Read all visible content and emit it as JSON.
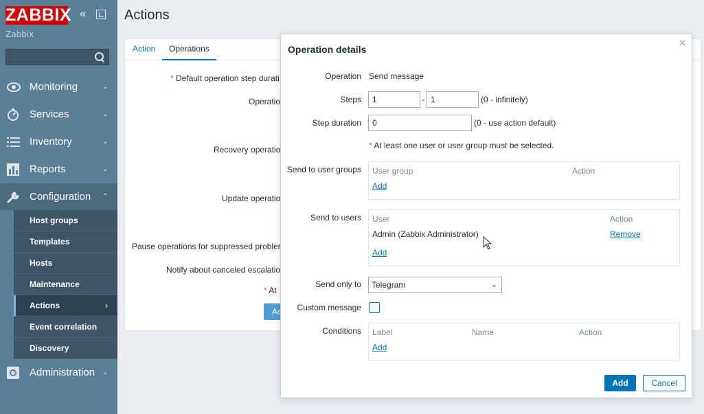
{
  "sidebar": {
    "logo": "ZABBIX",
    "server_name": "Zabbix",
    "search_placeholder": "",
    "menu": [
      {
        "label": "Monitoring",
        "icon": "eye-icon"
      },
      {
        "label": "Services",
        "icon": "stopwatch-icon"
      },
      {
        "label": "Inventory",
        "icon": "list-icon"
      },
      {
        "label": "Reports",
        "icon": "bar-chart-icon"
      },
      {
        "label": "Configuration",
        "icon": "wrench-icon"
      },
      {
        "label": "Administration",
        "icon": "gear-icon"
      }
    ],
    "submenu": [
      {
        "label": "Host groups"
      },
      {
        "label": "Templates"
      },
      {
        "label": "Hosts"
      },
      {
        "label": "Maintenance"
      },
      {
        "label": "Actions",
        "active": true
      },
      {
        "label": "Event correlation"
      },
      {
        "label": "Discovery"
      }
    ]
  },
  "main": {
    "title": "Actions",
    "tabs": [
      {
        "label": "Action"
      },
      {
        "label": "Operations"
      }
    ],
    "form": {
      "default_step_duration": "Default operation step durati",
      "operations": "Operatio",
      "recovery_operations": "Recovery operatio",
      "update_operations": "Update operatio",
      "pause_suppressed": "Pause operations for suppressed probler",
      "notify_canceled": "Notify about canceled escalatio",
      "at_least": "At",
      "button": "Ac"
    }
  },
  "modal": {
    "title": "Operation details",
    "close": "×",
    "operation_label": "Operation",
    "operation_value": "Send message",
    "steps_label": "Steps",
    "steps_from": "1",
    "steps_sep": "-",
    "steps_to": "1",
    "steps_hint": "(0 - infinitely)",
    "step_duration_label": "Step duration",
    "step_duration_value": "0",
    "step_duration_hint": "(0 - use action default)",
    "requirement_note": "At least one user or user group must be selected.",
    "user_groups_label": "Send to user groups",
    "user_groups_headers": {
      "col1": "User group",
      "col2": "Action"
    },
    "add_link": "Add",
    "users_label": "Send to users",
    "users_headers": {
      "col1": "User",
      "col2": "Action"
    },
    "users_rows": [
      {
        "user": "Admin (Zabbix Administrator)",
        "action": "Remove"
      }
    ],
    "send_only_to_label": "Send only to",
    "send_only_to_value": "Telegram",
    "custom_message_label": "Custom message",
    "custom_message_checked": false,
    "conditions_label": "Conditions",
    "conditions_headers": {
      "col1": "Label",
      "col2": "Name",
      "col3": "Action"
    },
    "add_button": "Add",
    "cancel_button": "Cancel"
  },
  "colors": {
    "brand_red": "#d40000",
    "sidebar_bg": "#5b7f96",
    "link": "#0275b8",
    "required": "#e45959"
  }
}
